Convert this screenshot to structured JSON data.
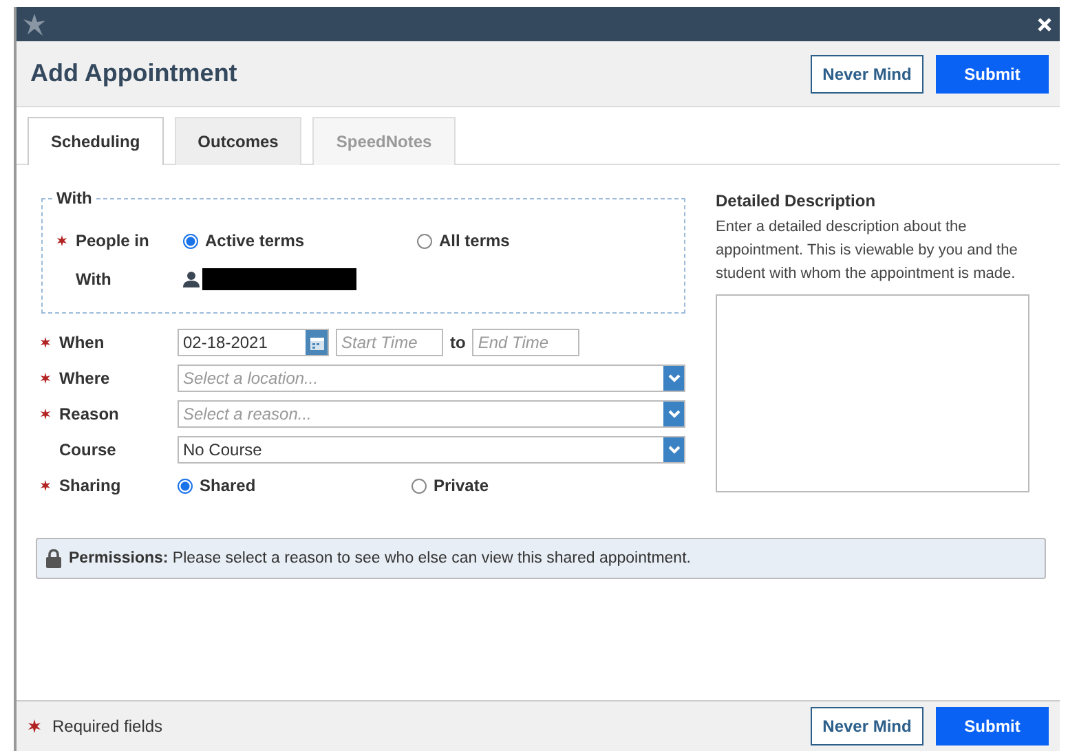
{
  "title": "Add Appointment",
  "header_buttons": [
    {
      "label": "Never Mind",
      "kind": "secondary"
    },
    {
      "label": "Submit",
      "kind": "primary"
    }
  ],
  "tabs": [
    {
      "label": "Scheduling",
      "selected": true,
      "disabled": false
    },
    {
      "label": "Outcomes",
      "selected": false,
      "disabled": false
    },
    {
      "label": "SpeedNotes",
      "selected": false,
      "disabled": true
    }
  ],
  "with_group": {
    "legend": "With",
    "people_in": {
      "label": "People in",
      "required": true,
      "options": [
        {
          "label": "Active terms",
          "selected": true
        },
        {
          "label": "All terms",
          "selected": false
        }
      ]
    },
    "with_label": "With"
  },
  "fields": [
    {
      "kind": "date",
      "label": "When",
      "required": true,
      "date": "02-18-2021",
      "start_placeholder": "Start Time",
      "separator": "to",
      "end_placeholder": "End Time"
    },
    {
      "kind": "select",
      "label": "Where",
      "required": true,
      "placeholder": "Select a location..."
    },
    {
      "kind": "select",
      "label": "Reason",
      "required": true,
      "placeholder": "Select a reason..."
    },
    {
      "kind": "select",
      "label": "Course",
      "required": false,
      "value": "No Course"
    },
    {
      "kind": "radio",
      "label": "Sharing",
      "required": true,
      "options": [
        {
          "label": "Shared",
          "selected": true
        },
        {
          "label": "Private",
          "selected": false
        }
      ]
    }
  ],
  "description": {
    "title": "Detailed Description",
    "hint": "Enter a detailed description about the appointment. This is viewable by you and the student with whom the appointment is made."
  },
  "permissions": "**Permissions:** Please select a reason to see who else can view this shared appointment.",
  "footer": {
    "required_note": "Required fields",
    "buttons": [
      {
        "label": "Never Mind",
        "kind": "secondary"
      },
      {
        "label": "Submit",
        "kind": "primary"
      }
    ]
  }
}
